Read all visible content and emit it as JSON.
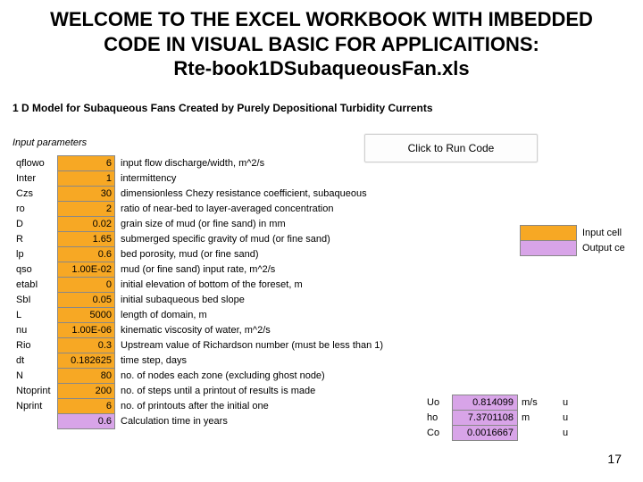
{
  "title_line1": "WELCOME TO THE EXCEL WORKBOOK WITH IMBEDDED",
  "title_line2": "CODE IN VISUAL BASIC FOR APPLICAITIONS:",
  "title_line3": "Rte-book1DSubaqueousFan.xls",
  "subtitle": "1 D Model for Subaqueous Fans Created by Purely Depositional Turbidity Currents",
  "input_params_label": "Input parameters",
  "run_button": "Click to Run Code",
  "rows": [
    {
      "name": "qflowo",
      "val": "6",
      "desc": "input flow discharge/width, m^2/s",
      "cls": "orange"
    },
    {
      "name": "Inter",
      "val": "1",
      "desc": "intermittency",
      "cls": "orange"
    },
    {
      "name": "Czs",
      "val": "30",
      "desc": "dimensionless Chezy resistance coefficient, subaqueous",
      "cls": "orange"
    },
    {
      "name": "ro",
      "val": "2",
      "desc": "ratio of near-bed to layer-averaged concentration",
      "cls": "orange"
    },
    {
      "name": "D",
      "val": "0.02",
      "desc": "grain size of mud (or fine sand) in mm",
      "cls": "orange"
    },
    {
      "name": "R",
      "val": "1.65",
      "desc": "submerged specific gravity of mud (or fine sand)",
      "cls": "orange"
    },
    {
      "name": "lp",
      "val": "0.6",
      "desc": "bed porosity, mud (or fine sand)",
      "cls": "orange"
    },
    {
      "name": "qso",
      "val": "1.00E-02",
      "desc": "mud (or fine sand) input rate, m^2/s",
      "cls": "orange"
    },
    {
      "name": "etabI",
      "val": "0",
      "desc": "initial elevation of bottom of the foreset, m",
      "cls": "orange"
    },
    {
      "name": "SbI",
      "val": "0.05",
      "desc": "initial subaqueous bed slope",
      "cls": "orange"
    },
    {
      "name": "L",
      "val": "5000",
      "desc": "length of domain, m",
      "cls": "orange"
    },
    {
      "name": "nu",
      "val": "1.00E-06",
      "desc": "kinematic viscosity of water, m^2/s",
      "cls": "orange"
    },
    {
      "name": "Rio",
      "val": "0.3",
      "desc": "Upstream value of Richardson number (must be less than 1)",
      "cls": "orange"
    },
    {
      "name": "dt",
      "val": "0.182625",
      "desc": "time step, days",
      "cls": "orange"
    },
    {
      "name": "N",
      "val": "80",
      "desc": "no. of nodes each zone (excluding ghost node)",
      "cls": "orange"
    },
    {
      "name": "Ntoprint",
      "val": "200",
      "desc": "no. of steps until a printout of results is made",
      "cls": "orange"
    },
    {
      "name": "Nprint",
      "val": "6",
      "desc": "no. of printouts after the initial one",
      "cls": "orange"
    },
    {
      "name": "",
      "val": "0.6",
      "desc": "Calculation time in years",
      "cls": "purple"
    }
  ],
  "legend": {
    "input": "Input cell",
    "output": "Output ce"
  },
  "outputs": [
    {
      "name": "Uo",
      "val": "0.814099",
      "unit": "m/s",
      "x": "u",
      "cls": "purple"
    },
    {
      "name": "ho",
      "val": "7.3701108",
      "unit": "m",
      "x": "u",
      "cls": "purple"
    },
    {
      "name": "Co",
      "val": "0.0016667",
      "unit": "",
      "x": "u",
      "cls": "purple"
    }
  ],
  "page_number": "17"
}
